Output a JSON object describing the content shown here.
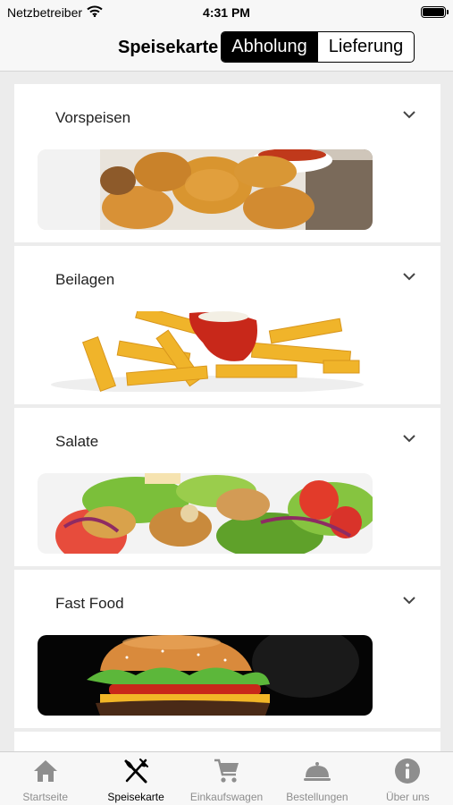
{
  "status_bar": {
    "carrier": "Netzbetreiber",
    "time": "4:31 PM"
  },
  "nav": {
    "title": "Speisekarte",
    "segments": [
      "Abholung",
      "Lieferung"
    ],
    "selected_segment": "Abholung"
  },
  "categories": [
    {
      "label": "Vorspeisen",
      "image": "chicken-nuggets"
    },
    {
      "label": "Beilagen",
      "image": "french-fries-with-ketchup"
    },
    {
      "label": "Salate",
      "image": "salad"
    },
    {
      "label": "Fast Food",
      "image": "burger"
    }
  ],
  "tabs": [
    {
      "label": "Startseite",
      "icon": "home-icon",
      "active": false
    },
    {
      "label": "Speisekarte",
      "icon": "fork-knife-icon",
      "active": true
    },
    {
      "label": "Einkaufswagen",
      "icon": "cart-icon",
      "active": false
    },
    {
      "label": "Bestellungen",
      "icon": "cloche-icon",
      "active": false
    },
    {
      "label": "Über uns",
      "icon": "info-icon",
      "active": false
    }
  ],
  "colors": {
    "active": "#000000",
    "inactive": "#8e8e8e",
    "background": "#ececec"
  }
}
